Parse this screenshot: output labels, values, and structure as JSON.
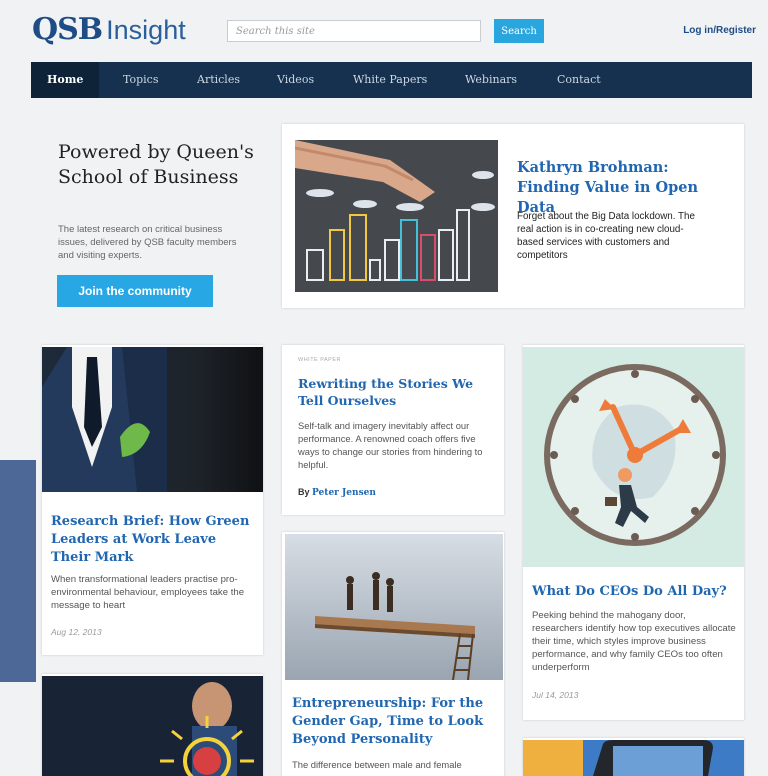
{
  "header": {
    "logo_qsb": "QSB",
    "logo_insight": "Insight",
    "search_placeholder": "Search this site",
    "search_button": "Search",
    "login": "Log in/Register"
  },
  "nav": {
    "items": [
      "Home",
      "Topics",
      "Articles",
      "Videos",
      "White Papers",
      "Webinars",
      "Contact"
    ]
  },
  "promo": {
    "title": "Powered by Queen's School of Business",
    "description": "The latest research on critical business issues, delivered by QSB faculty members and visiting experts.",
    "button": "Join the community"
  },
  "feature": {
    "title": "Kathryn Brohman: Finding Value in Open Data",
    "text": "Forget about the Big Data lockdown. The real action is in co-creating new cloud-based services with customers and competitors"
  },
  "articles": {
    "green": {
      "title": "Research Brief: How Green Leaders at Work Leave Their Mark",
      "text": "When transformational leaders practise pro-environmental behaviour, employees take the message to heart",
      "date": "Aug 12, 2013"
    },
    "stories": {
      "kicker": "WHITE PAPER",
      "title": "Rewriting the Stories We Tell Ourselves",
      "text": "Self-talk and imagery inevitably affect our performance. A renowned coach offers five ways to change our stories from hindering to helpful.",
      "byline_prefix": "By",
      "author": "Peter Jensen"
    },
    "ceos": {
      "title": "What Do CEOs Do All Day?",
      "text": "Peeking behind the mahogany door, researchers identify how top executives allocate their time, which styles improve business performance, and why family CEOs too often underperform",
      "date": "Jul 14, 2013"
    },
    "entrepreneurship": {
      "title": "Entrepreneurship: For the Gender Gap, Time to Look Beyond Personality",
      "text": "The difference between male and female"
    }
  },
  "colors": {
    "nav": "#16314f",
    "accent": "#27a7e3",
    "headline": "#2066b0",
    "side_tab": "#4d6797"
  }
}
